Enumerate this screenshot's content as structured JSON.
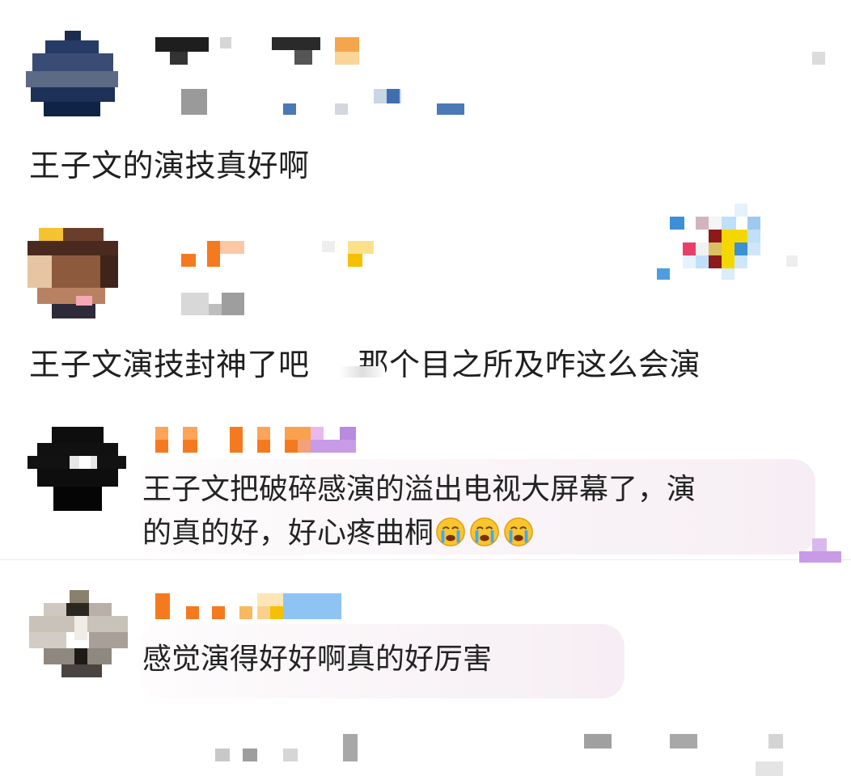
{
  "comments": [
    {
      "text": "王子文的演技真好啊"
    },
    {
      "text_part1": "王子文演技封神了吧",
      "text_part2": "那个目之所及咋这么会演"
    },
    {
      "line1": "王子文把破碎感演的溢出电视大屏幕了，演",
      "line2": "的真的好，好心疼曲桐"
    },
    {
      "text": "感觉演得好好啊真的好厉害"
    }
  ],
  "emoji": {
    "name": "crying-face-icon",
    "count": 3
  },
  "colors": {
    "text": "#1f1f1f",
    "bubble": "#f7eef2",
    "pixel_orange": "#f57a1f",
    "pixel_purple": "#c79be6"
  }
}
